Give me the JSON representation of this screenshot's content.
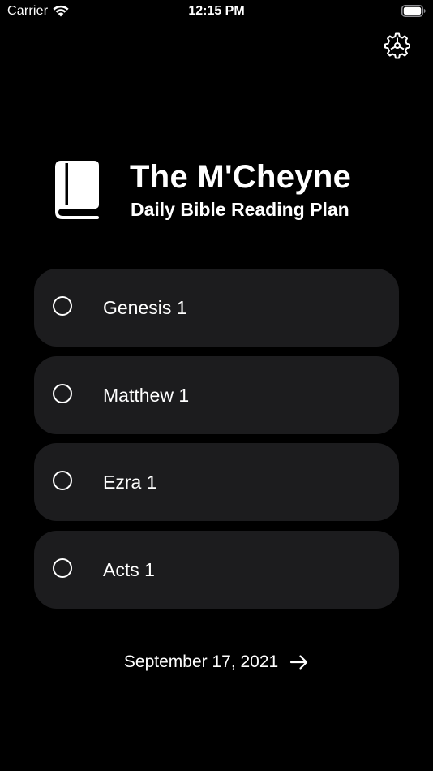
{
  "status_bar": {
    "carrier": "Carrier",
    "time": "12:15 PM"
  },
  "header": {
    "icon": "book-icon",
    "title": "The M'Cheyne",
    "subtitle": "Daily Bible Reading Plan"
  },
  "readings": [
    {
      "label": "Genesis 1",
      "checked": false
    },
    {
      "label": "Matthew 1",
      "checked": false
    },
    {
      "label": "Ezra 1",
      "checked": false
    },
    {
      "label": "Acts 1",
      "checked": false
    }
  ],
  "date_nav": {
    "date": "September 17, 2021",
    "icon": "arrow-right-icon"
  },
  "colors": {
    "background": "#000000",
    "card": "#1c1c1e",
    "text": "#ffffff"
  }
}
